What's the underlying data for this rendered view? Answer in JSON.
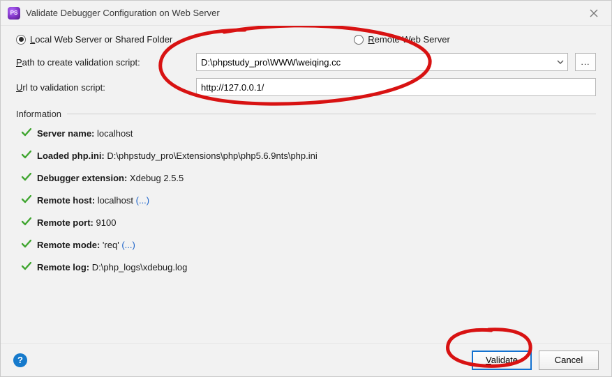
{
  "window": {
    "title": "Validate Debugger Configuration on Web Server"
  },
  "radios": {
    "local_label": "Local Web Server or Shared Folder",
    "remote_label": "Remote Web Server",
    "selected": "local"
  },
  "fields": {
    "path_label": "Path to create validation script:",
    "path_value": "D:\\phpstudy_pro\\WWW\\weiqing.cc",
    "url_label": "Url to validation script:",
    "url_value": "http://127.0.0.1/",
    "browse_label": "..."
  },
  "section": {
    "information_label": "Information"
  },
  "info_items": [
    {
      "label": "Server name:",
      "value": "localhost"
    },
    {
      "label": "Loaded php.ini:",
      "value": "D:\\phpstudy_pro\\Extensions\\php\\php5.6.9nts\\php.ini"
    },
    {
      "label": "Debugger extension:",
      "value": "Xdebug 2.5.5"
    },
    {
      "label": "Remote host:",
      "value": "localhost",
      "link": "(...)"
    },
    {
      "label": "Remote port:",
      "value": "9100"
    },
    {
      "label": "Remote mode:",
      "value": "'req'",
      "link": "(...)"
    },
    {
      "label": "Remote log:",
      "value": "D:\\php_logs\\xdebug.log"
    }
  ],
  "buttons": {
    "validate": "Validate",
    "cancel": "Cancel"
  },
  "help_tooltip": "?"
}
